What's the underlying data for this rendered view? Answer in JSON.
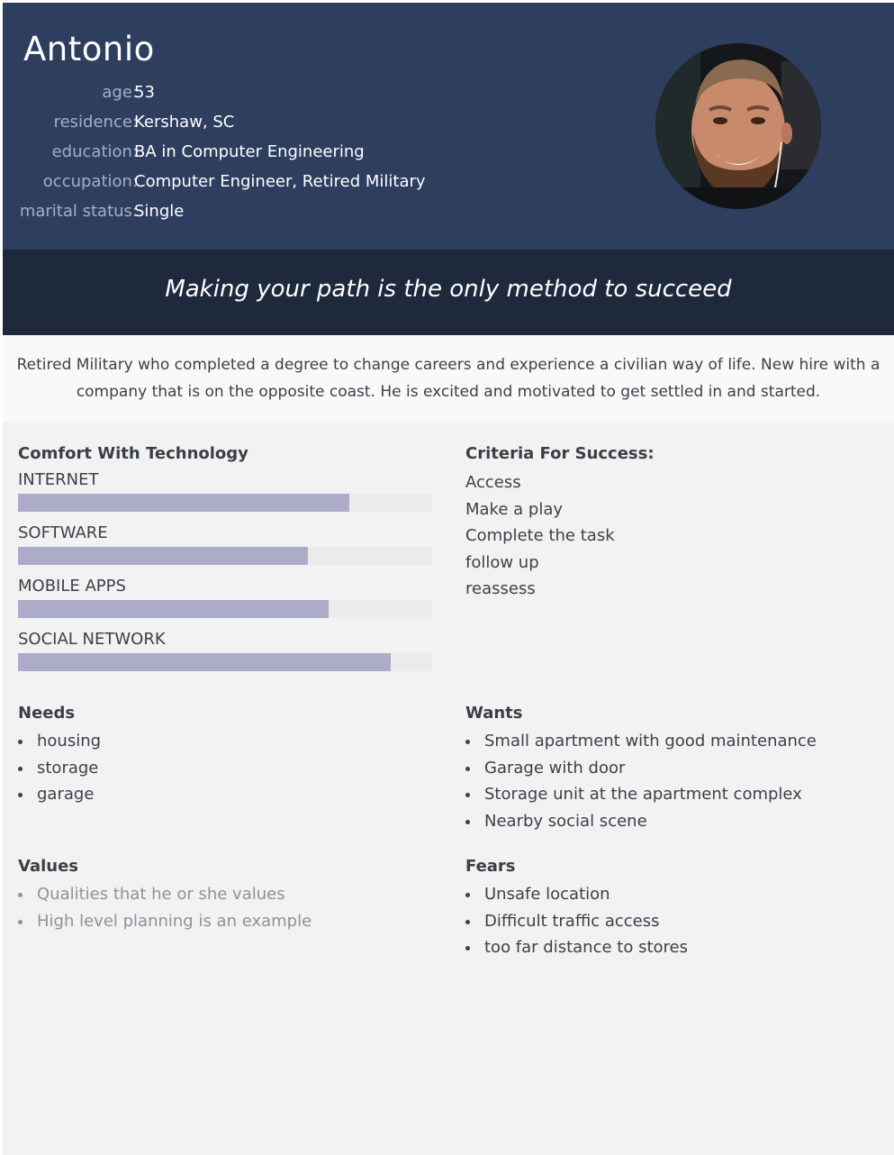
{
  "persona": {
    "name": "Antonio",
    "facts": [
      {
        "label": "age:",
        "value": "53"
      },
      {
        "label": "residence:",
        "value": "Kershaw, SC"
      },
      {
        "label": "education:",
        "value": "BA in Computer Engineering"
      },
      {
        "label": "occupation:",
        "value": "Computer Engineer, Retired Military"
      },
      {
        "label": "marital status:",
        "value": "Single"
      }
    ]
  },
  "quote": "Making your path is the only method to succeed",
  "bio": "Retired Military who completed a degree to change careers and experience a civilian way of life. New hire with a company that is on the opposite coast. He is excited and motivated to get settled in and started.",
  "technology": {
    "title": "Comfort With Technology",
    "items": [
      {
        "label": "INTERNET",
        "level": 0.8
      },
      {
        "label": "SOFTWARE",
        "level": 0.7
      },
      {
        "label": "MOBILE APPS",
        "level": 0.75
      },
      {
        "label": "SOCIAL NETWORK",
        "level": 0.9
      }
    ]
  },
  "criteria": {
    "title": "Criteria For Success:",
    "items": [
      "Access",
      "Make a play",
      "Complete the task",
      "follow up",
      "reassess"
    ]
  },
  "needs": {
    "title": "Needs",
    "items": [
      "housing",
      "storage",
      "garage"
    ]
  },
  "wants": {
    "title": "Wants",
    "items": [
      "Small apartment with good maintenance",
      "Garage with door",
      "Storage unit at the apartment complex",
      "Nearby social scene"
    ]
  },
  "values": {
    "title": "Values",
    "items": [
      "Qualities that he or she values",
      "High level planning is an example"
    ]
  },
  "fears": {
    "title": "Fears",
    "items": [
      "Unsafe location",
      "Difficult traffic access",
      "too far distance to stores"
    ]
  },
  "colors": {
    "header_bg": "#2d3e5f",
    "banner_bg": "#1e293c",
    "bar_fill": "#adacc8",
    "bar_track": "#ebebeb"
  },
  "icons": {
    "avatar": "profile-photo"
  }
}
